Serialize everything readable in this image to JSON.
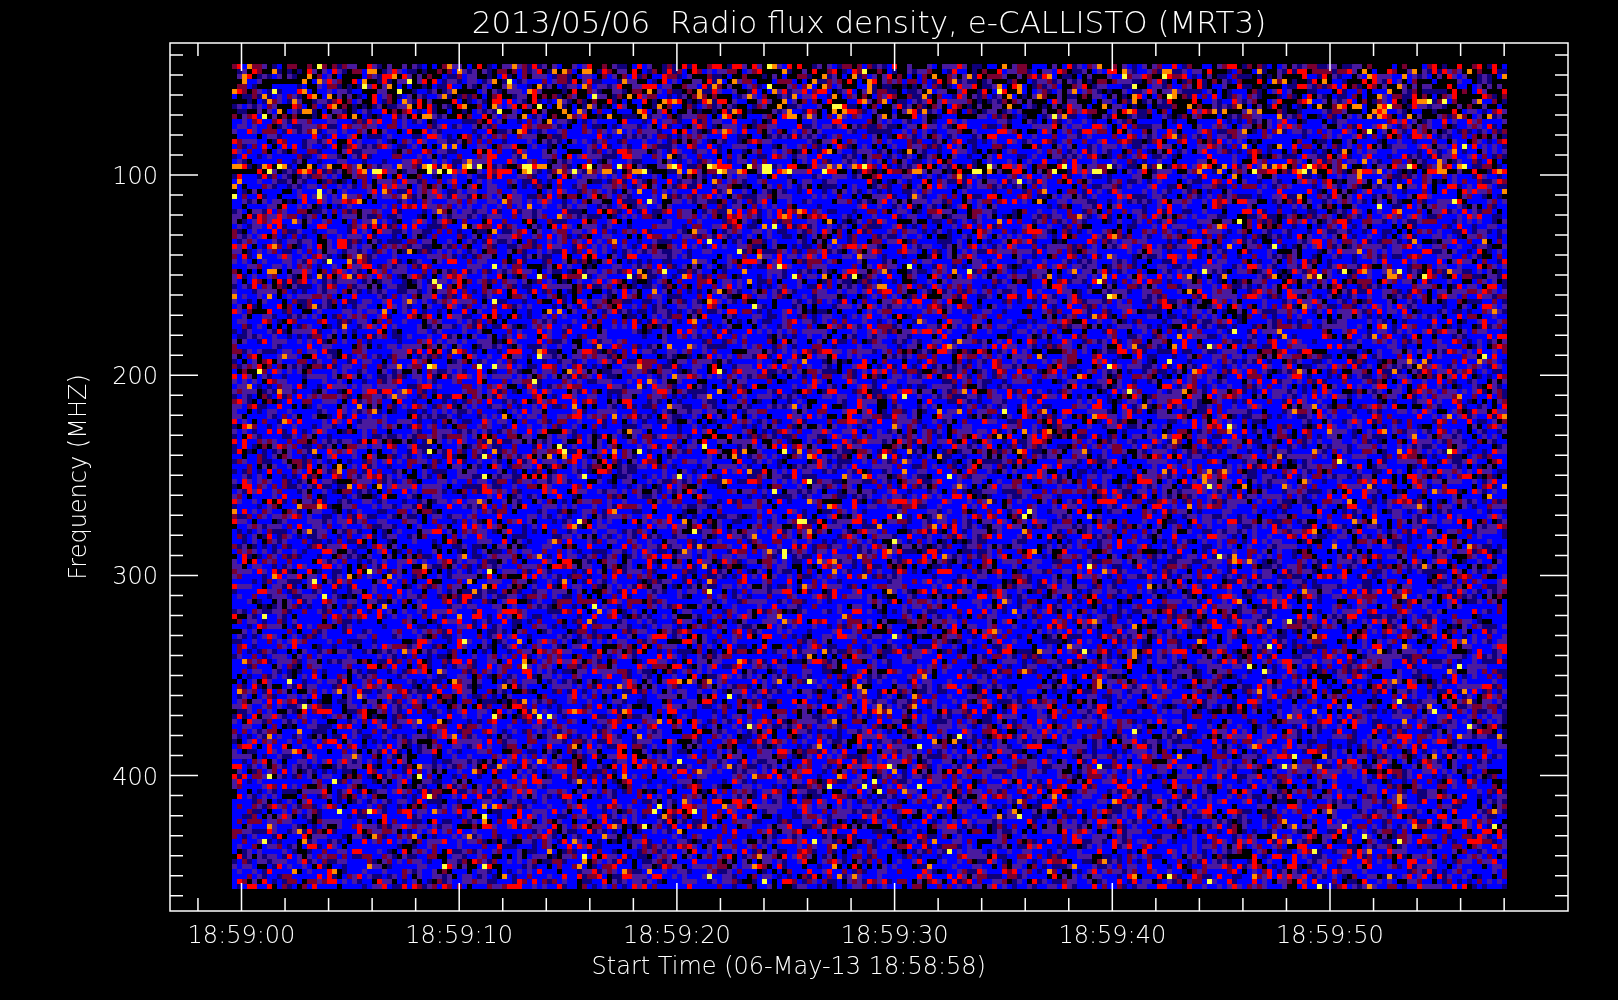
{
  "plot": {
    "title": "2013/05/06  Radio flux density, e-CALLISTO (MRT3)",
    "ylabel": "Frequency (MHZ)",
    "xlabel": "Start Time (06-May-13 18:58:58)",
    "y_ticks": [
      "100",
      "200",
      "300",
      "400"
    ],
    "x_ticks": [
      "18:59:00",
      "18:59:10",
      "18:59:20",
      "18:59:30",
      "18:59:40",
      "18:59:50"
    ]
  }
}
